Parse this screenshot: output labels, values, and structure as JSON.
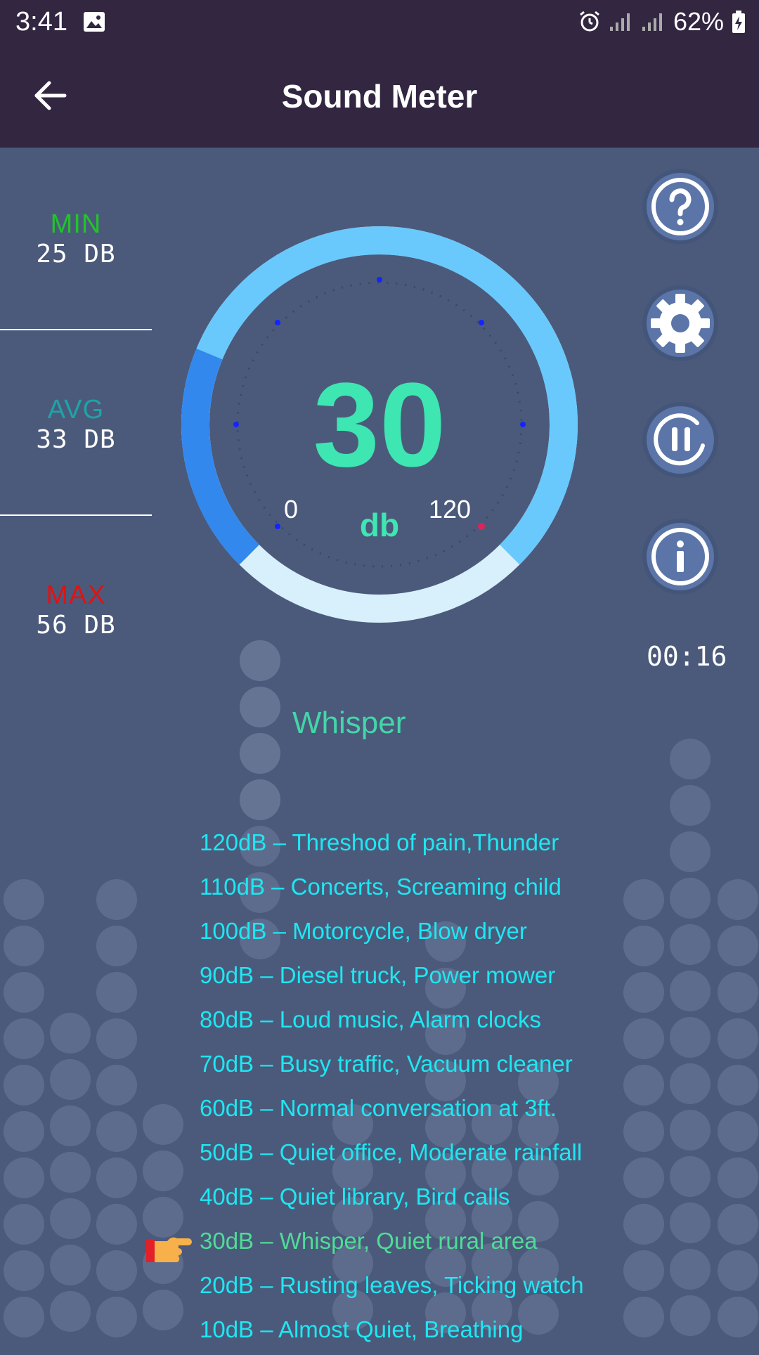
{
  "status_bar": {
    "time": "3:41",
    "battery": "62%"
  },
  "app_bar": {
    "title": "Sound Meter"
  },
  "stats": {
    "min_label": "MIN",
    "min_value": "25 DB",
    "avg_label": "AVG",
    "avg_value": "33 DB",
    "max_label": "MAX",
    "max_value": "56 DB"
  },
  "gauge": {
    "value": "30",
    "unit": "db",
    "scale_min": "0",
    "scale_max": "120",
    "level": 0.25
  },
  "timer": "00:16",
  "level_name": "Whisper",
  "reference": [
    "120dB – Threshod of pain,Thunder",
    "110dB – Concerts, Screaming child",
    "100dB – Motorcycle, Blow dryer",
    "90dB – Diesel truck, Power mower",
    "80dB – Loud music, Alarm clocks",
    "70dB – Busy traffic, Vacuum cleaner",
    "60dB – Normal conversation at 3ft.",
    "50dB – Quiet office, Moderate rainfall",
    "40dB – Quiet library, Bird calls",
    "30dB – Whisper, Quiet rural area",
    "20dB – Rusting leaves, Ticking watch",
    "10dB – Almost Quiet, Breathing"
  ],
  "active_reference_index": 9,
  "colors": {
    "background": "#4b5a7b",
    "bar": "#322641",
    "accent": "#3ee6b1",
    "min": "#22c32b",
    "avg": "#1fa3a7",
    "max": "#e01313",
    "list": "#1ee7f2"
  },
  "icons": [
    "back-arrow-icon",
    "help-icon",
    "settings-icon",
    "pause-icon",
    "info-icon",
    "pointing-hand-icon"
  ]
}
